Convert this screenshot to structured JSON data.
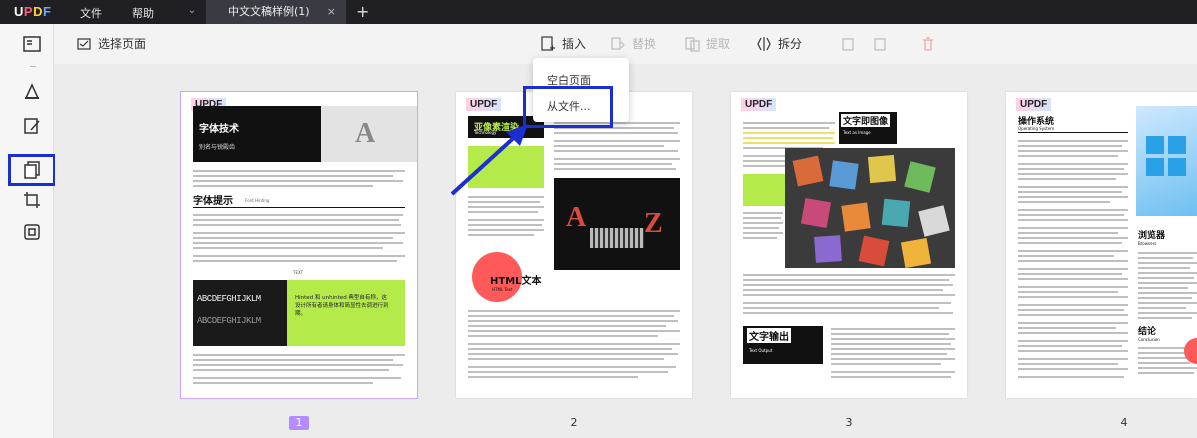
{
  "app": {
    "logo": {
      "u": "U",
      "p": "P",
      "d": "D",
      "f": "F"
    },
    "menu": [
      "文件",
      "帮助"
    ],
    "tab_title": "中文文稿样例(1)",
    "tab_close": "×",
    "tab_dropdown": "⌄",
    "new_tab": "+"
  },
  "toolbar": {
    "select_pages": "选择页面",
    "insert": "插入",
    "replace": "替换",
    "extract": "提取",
    "split": "拆分"
  },
  "insert_menu": {
    "options": [
      "空白页面",
      "从文件..."
    ]
  },
  "pages": [
    {
      "number": "1",
      "badge": "UPDF",
      "title": "字体技术",
      "subtitle": "别名与锐殿齿",
      "section": "字体提示",
      "section_sub": "Font Hinting",
      "caption": "TEXT",
      "letters": "ABCDEFGHIJKLM",
      "box_text": "Hinted 和 unhinted 典型自有称，这设计所有者请身体和简显性去调进行到期。"
    },
    {
      "number": "2",
      "badge": "UPDF",
      "title": "亚像素渲染",
      "subtitle": "Technology",
      "section": "HTML文本",
      "section_sub": "HTML Text"
    },
    {
      "number": "3",
      "badge": "UPDF",
      "title": "文字即图像",
      "subtitle": "Text as Image",
      "section": "文字输出",
      "section_sub": "Text Output"
    },
    {
      "number": "4",
      "badge": "UPDF",
      "title": "操作系统",
      "subtitle": "Operating System",
      "section": "浏览器",
      "section_sub": "Browsers",
      "section2": "结论",
      "section2_sub": "Conclusion"
    }
  ],
  "colors": {
    "accent_highlight": "#1b2ed1",
    "selected_page": "#b48cff",
    "green_block": "#b5ea4b",
    "red_circle": "#ff5a5a",
    "titlebar": "#1f1f24"
  }
}
